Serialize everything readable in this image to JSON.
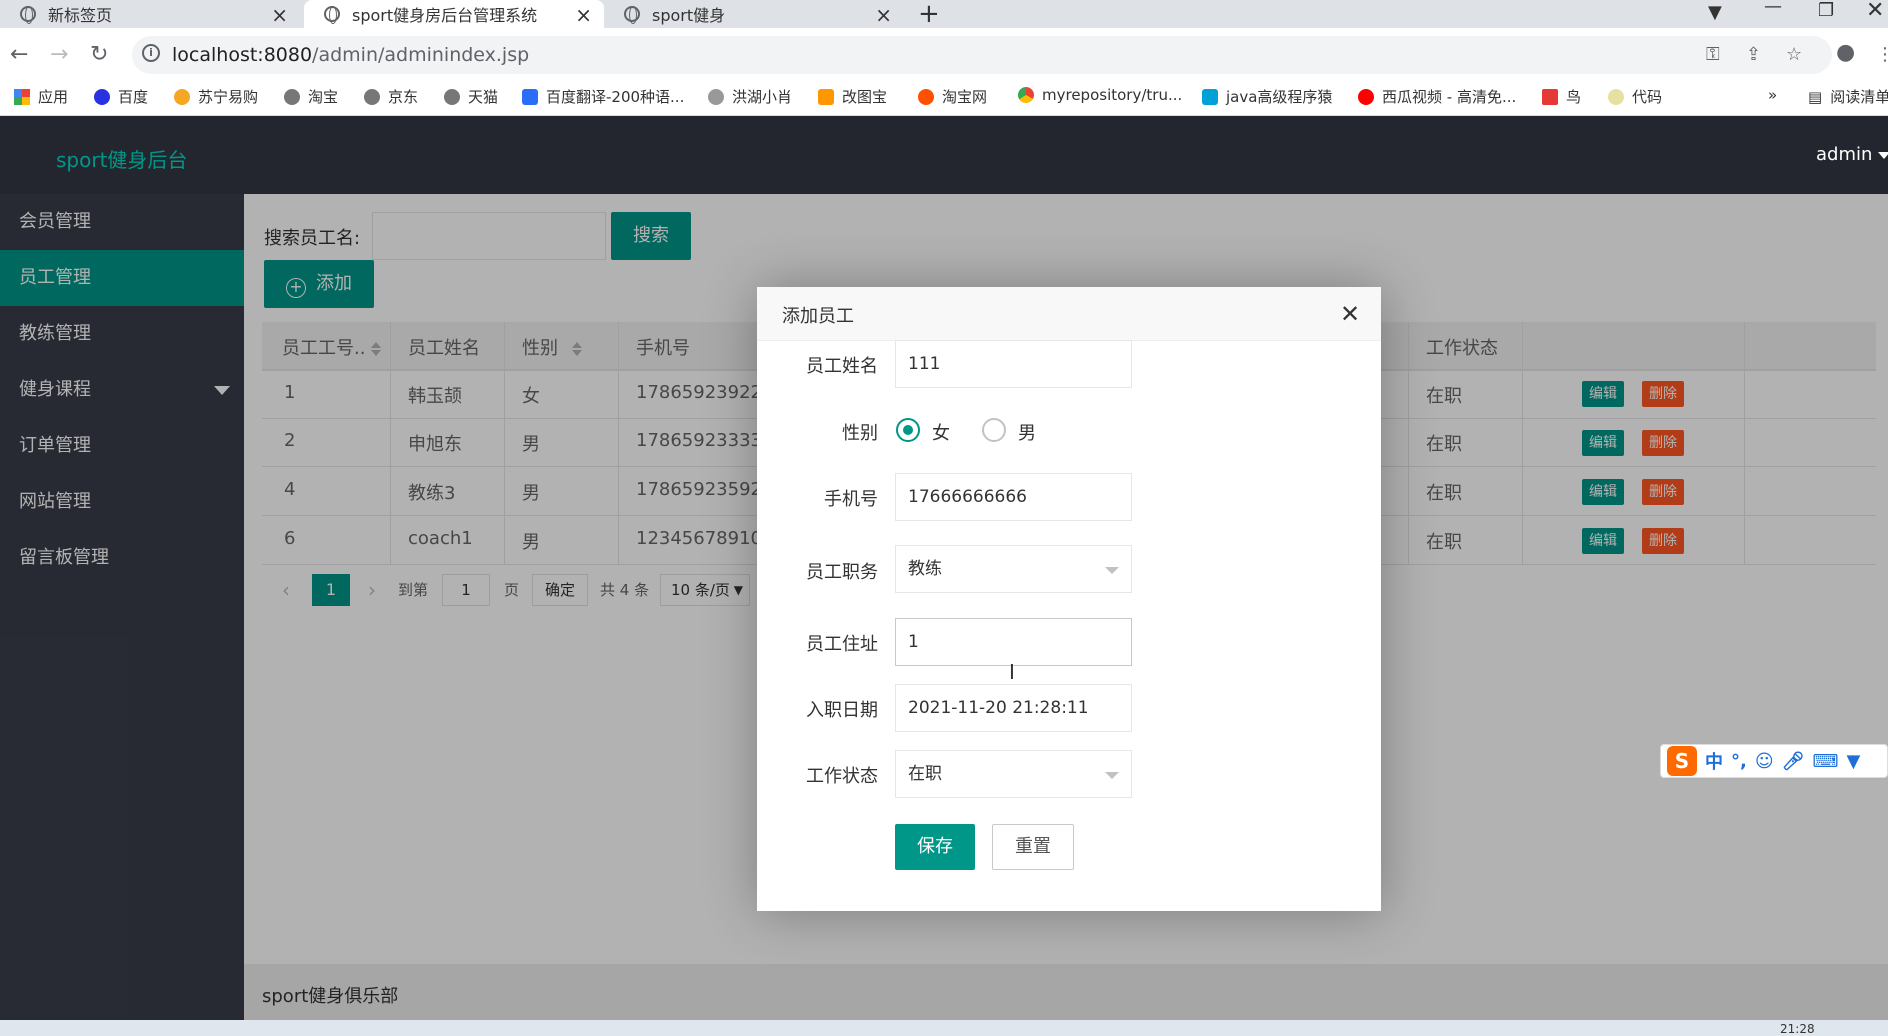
{
  "browser": {
    "tabs": [
      {
        "label": "新标签页",
        "active": false
      },
      {
        "label": "sport健身房后台管理系统",
        "active": true
      },
      {
        "label": "sport健身",
        "active": false
      }
    ],
    "new_tab": "+",
    "url_host": "localhost:8080",
    "url_path": "/admin/adminindex.jsp",
    "bookmarks": [
      "应用",
      "百度",
      "苏宁易购",
      "淘宝",
      "京东",
      "天猫",
      "百度翻译-200种语...",
      "洪湖小肖",
      "改图宝",
      "淘宝网",
      "myrepository/tru...",
      "java高级程序猿",
      "西瓜视频 - 高清免...",
      "鸟",
      "代码"
    ],
    "bookmarks_more": "»",
    "reading_list": "阅读清单"
  },
  "app": {
    "logo": "sport健身后台",
    "user": "admin"
  },
  "sidebar": {
    "items": [
      {
        "label": "会员管理",
        "active": false
      },
      {
        "label": "员工管理",
        "active": true
      },
      {
        "label": "教练管理",
        "active": false
      },
      {
        "label": "健身课程",
        "active": false,
        "has_caret": true
      },
      {
        "label": "订单管理",
        "active": false
      },
      {
        "label": "网站管理",
        "active": false
      },
      {
        "label": "留言板管理",
        "active": false
      }
    ]
  },
  "toolbar": {
    "search_label": "搜索员工名:",
    "search_button": "搜索",
    "add_button": "添加",
    "add_icon": "+"
  },
  "table": {
    "headers": [
      "员工工号..",
      "员工姓名",
      "性别",
      "手机号",
      "工作状态"
    ],
    "rows": [
      {
        "id": "1",
        "name": "韩玉颉",
        "gender": "女",
        "phone": "17865923922",
        "status": "在职"
      },
      {
        "id": "2",
        "name": "申旭东",
        "gender": "男",
        "phone": "17865923333",
        "status": "在职"
      },
      {
        "id": "4",
        "name": "教练3",
        "gender": "男",
        "phone": "17865923592",
        "status": "在职"
      },
      {
        "id": "6",
        "name": "coach1",
        "gender": "男",
        "phone": "12345678910",
        "status": "在职"
      }
    ],
    "edit_label": "编辑",
    "delete_label": "删除"
  },
  "pager": {
    "prev": "‹",
    "current": "1",
    "next": "›",
    "goto_label": "到第",
    "goto_value": "1",
    "page_unit": "页",
    "confirm": "确定",
    "total": "共 4 条",
    "per_page": "10 条/页"
  },
  "dialog": {
    "title": "添加员工",
    "close": "✕",
    "fields": {
      "name_label": "员工姓名",
      "name_value": "111",
      "gender_label": "性别",
      "gender_female": "女",
      "gender_male": "男",
      "gender_selected": "女",
      "phone_label": "手机号",
      "phone_value": "17666666666",
      "position_label": "员工职务",
      "position_value": "教练",
      "address_label": "员工住址",
      "address_value": "1",
      "hire_date_label": "入职日期",
      "hire_date_value": "2021-11-20 21:28:11",
      "status_label": "工作状态",
      "status_value": "在职"
    },
    "save_button": "保存",
    "reset_button": "重置"
  },
  "footer": {
    "text": "sport健身俱乐部"
  },
  "ime": {
    "logo": "S",
    "mode": "中",
    "punct": "°,"
  },
  "taskbar": {
    "time": "21:28"
  },
  "colors": {
    "accent": "#009688",
    "danger": "#ff5722",
    "header_bg": "#23262e",
    "sidebar_bg": "#393d49"
  }
}
